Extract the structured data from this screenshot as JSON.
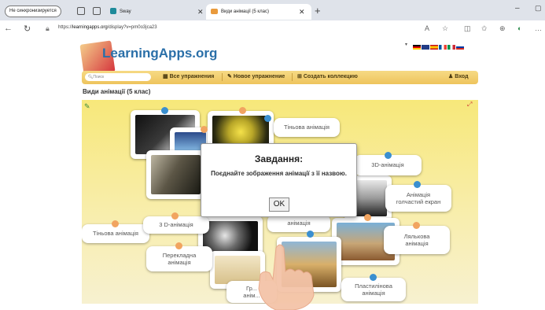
{
  "browser": {
    "profile_label": "Не синхронизируется",
    "tabs": [
      {
        "title": "Sway",
        "active": false
      },
      {
        "title": "Види анімації (5 клас)",
        "active": true
      }
    ],
    "new_tab": "+",
    "url_host": "learningapps.org",
    "url_prefix": "https://",
    "url_path": "/display?v=pm0o3jca23"
  },
  "site": {
    "logo": "LearningApps.org",
    "search_placeholder": "Поиск",
    "nav": {
      "all_exercises": "Все упражнения",
      "new_exercise": "Новое упражнение",
      "create_collection": "Создать коллекцию",
      "login": "Вход"
    },
    "page_title": "Види анімації (5 клас)"
  },
  "app": {
    "labels": {
      "shadow_top": "Тіньова анімація",
      "d3_right": "3D-анімація",
      "fullscreen": "Анімація\nголчастий екран",
      "shadow_left": "Тіньова анімація",
      "d3_left": "3 D-анімація",
      "overlay": "Перекладна\nанімація",
      "hidden_mid": "анімація",
      "puppet": "Лялькова\nанімація",
      "plasticine": "Пластилінова\nанімація",
      "drawn": "Гр...\nанім..."
    }
  },
  "dialog": {
    "title": "Завдання:",
    "text": "Поєднайте зображення анімації з її назвою.",
    "ok": "OK"
  },
  "colors": {
    "logo": "#2a6fa8",
    "toolbar": "#f1cd6b",
    "dot_blue": "#3a8fd0",
    "dot_orange": "#f1a460",
    "tab_bar": "#dfe3ea"
  }
}
